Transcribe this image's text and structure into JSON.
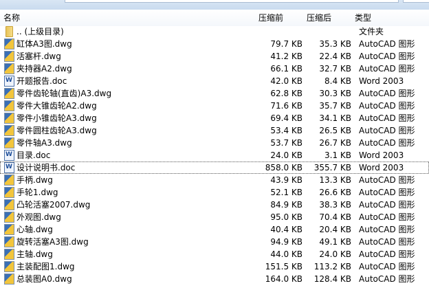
{
  "columns": {
    "name": "名称",
    "before": "压缩前",
    "after": "压缩后",
    "type": "类型"
  },
  "rows": [
    {
      "icon": "folder",
      "name": ".. (上级目录)",
      "before": "",
      "after": "",
      "type": "文件夹"
    },
    {
      "icon": "dwg",
      "name": "缸体A3图.dwg",
      "before": "79.7 KB",
      "after": "35.3 KB",
      "type": "AutoCAD 图形"
    },
    {
      "icon": "dwg",
      "name": "活塞杆.dwg",
      "before": "41.2 KB",
      "after": "22.4 KB",
      "type": "AutoCAD 图形"
    },
    {
      "icon": "dwg",
      "name": "夹持器A2.dwg",
      "before": "66.1 KB",
      "after": "32.7 KB",
      "type": "AutoCAD 图形"
    },
    {
      "icon": "doc",
      "name": "开题报告.doc",
      "before": "42.0 KB",
      "after": "8.4 KB",
      "type": "Word 2003"
    },
    {
      "icon": "dwg",
      "name": "零件齿轮轴(直齿)A3.dwg",
      "before": "62.8 KB",
      "after": "30.3 KB",
      "type": "AutoCAD 图形"
    },
    {
      "icon": "dwg",
      "name": "零件大锥齿轮A2.dwg",
      "before": "71.6 KB",
      "after": "35.7 KB",
      "type": "AutoCAD 图形"
    },
    {
      "icon": "dwg",
      "name": "零件小锥齿轮A3.dwg",
      "before": "69.4 KB",
      "after": "34.1 KB",
      "type": "AutoCAD 图形"
    },
    {
      "icon": "dwg",
      "name": "零件圆柱齿轮A3.dwg",
      "before": "53.4 KB",
      "after": "26.5 KB",
      "type": "AutoCAD 图形"
    },
    {
      "icon": "dwg",
      "name": "零件轴A3.dwg",
      "before": "53.7 KB",
      "after": "26.7 KB",
      "type": "AutoCAD 图形"
    },
    {
      "icon": "doc",
      "name": "目录.doc",
      "before": "24.0 KB",
      "after": "3.1 KB",
      "type": "Word 2003"
    },
    {
      "icon": "doc",
      "name": "设计说明书.doc",
      "before": "858.0 KB",
      "after": "355.7 KB",
      "type": "Word 2003",
      "selected": true
    },
    {
      "icon": "dwg",
      "name": "手柄.dwg",
      "before": "43.9 KB",
      "after": "13.3 KB",
      "type": "AutoCAD 图形"
    },
    {
      "icon": "dwg",
      "name": "手轮1.dwg",
      "before": "52.1 KB",
      "after": "26.6 KB",
      "type": "AutoCAD 图形"
    },
    {
      "icon": "dwg",
      "name": "凸轮活塞2007.dwg",
      "before": "84.9 KB",
      "after": "38.3 KB",
      "type": "AutoCAD 图形"
    },
    {
      "icon": "dwg",
      "name": "外观图.dwg",
      "before": "95.0 KB",
      "after": "70.4 KB",
      "type": "AutoCAD 图形"
    },
    {
      "icon": "dwg",
      "name": "心轴.dwg",
      "before": "40.4 KB",
      "after": "20.4 KB",
      "type": "AutoCAD 图形"
    },
    {
      "icon": "dwg",
      "name": "旋转活塞A3图.dwg",
      "before": "94.9 KB",
      "after": "49.1 KB",
      "type": "AutoCAD 图形"
    },
    {
      "icon": "dwg",
      "name": "主轴.dwg",
      "before": "44.0 KB",
      "after": "24.0 KB",
      "type": "AutoCAD 图形"
    },
    {
      "icon": "dwg",
      "name": "主装配图1.dwg",
      "before": "151.5 KB",
      "after": "113.2 KB",
      "type": "AutoCAD 图形"
    },
    {
      "icon": "dwg",
      "name": "总装图A0.dwg",
      "before": "164.0 KB",
      "after": "128.4 KB",
      "type": "AutoCAD 图形"
    }
  ]
}
